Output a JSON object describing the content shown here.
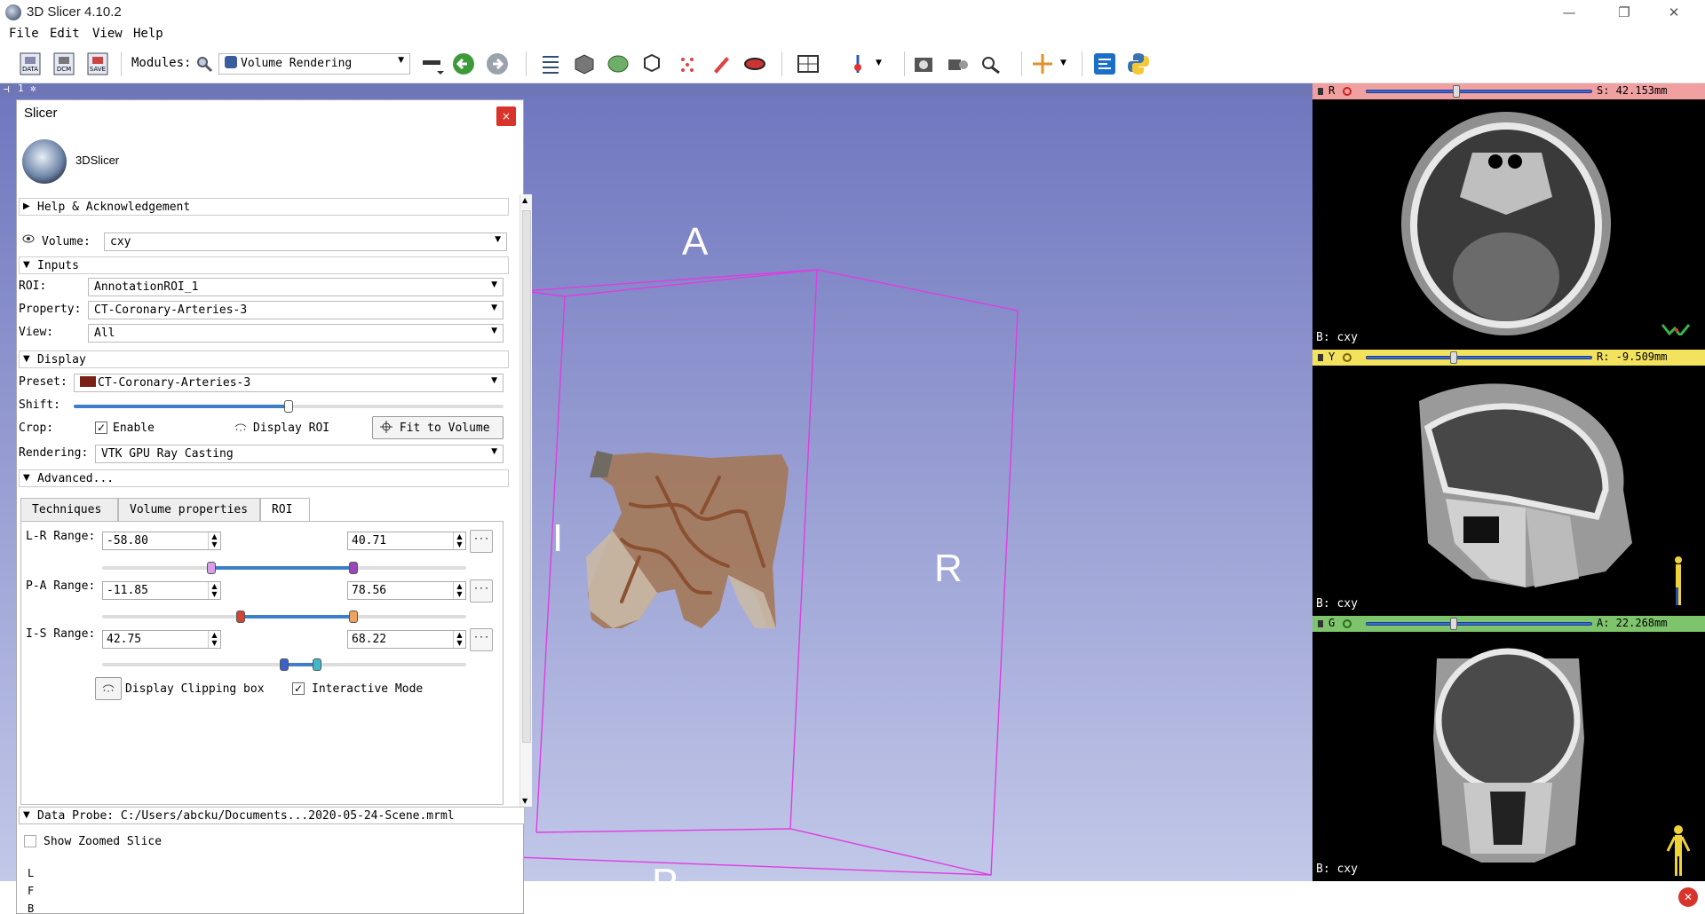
{
  "window": {
    "title": "3D Slicer 4.10.2",
    "minimize": "—",
    "restore": "❐",
    "close": "✕"
  },
  "menu": [
    "File",
    "Edit",
    "View",
    "Help"
  ],
  "toolbar": {
    "modules_label": "Modules:",
    "module_selected": "Volume Rendering",
    "data_label": "DATA",
    "dcm_label": "DCM",
    "save_label": "SAVE"
  },
  "viewstrip": {
    "label": "1"
  },
  "view3d": {
    "labels": {
      "anterior": "A",
      "right": "R",
      "inferior": "I",
      "posterior": "P"
    }
  },
  "slices": [
    {
      "color": "#f0a0a0",
      "letter": "R",
      "value": "S: 42.153mm",
      "knob_frac": 0.4,
      "volume": "B: cxy"
    },
    {
      "color": "#f3e25e",
      "letter": "Y",
      "value": "R: -9.509mm",
      "knob_frac": 0.39,
      "volume": "B: cxy"
    },
    {
      "color": "#7ec46d",
      "letter": "G",
      "value": "A: 22.268mm",
      "knob_frac": 0.39,
      "volume": "B: cxy"
    }
  ],
  "panel": {
    "title": "Slicer",
    "close": "×",
    "logo_text": "3DSlicer",
    "help_section": "Help & Acknowledgement",
    "volume_label": "Volume:",
    "volume_value": "cxy",
    "inputs_section": "Inputs",
    "roi_label": "ROI:",
    "roi_value": "AnnotationROI_1",
    "property_label": "Property:",
    "property_value": "CT-Coronary-Arteries-3",
    "view_label": "View:",
    "view_value": "All",
    "display_section": "Display",
    "preset_label": "Preset:",
    "preset_value": "CT-Coronary-Arteries-3",
    "shift_label": "Shift:",
    "shift_frac": 0.5,
    "crop_label": "Crop:",
    "enable_label": "Enable",
    "display_roi_label": "Display ROI",
    "fit_button": "Fit to Volume",
    "rendering_label": "Rendering:",
    "rendering_value": "VTK GPU Ray Casting",
    "advanced_section": "Advanced...",
    "tabs": [
      "Techniques",
      "Volume properties",
      "ROI"
    ],
    "lr": {
      "label": "L-R Range:",
      "min": "-58.80",
      "max": "40.71",
      "lo_frac": 0.3,
      "hi_frac": 0.69,
      "lo_color": "#d89ee6",
      "hi_color": "#9a47b8"
    },
    "pa": {
      "label": "P-A Range:",
      "min": "-11.85",
      "max": "78.56",
      "lo_frac": 0.38,
      "hi_frac": 0.69,
      "lo_color": "#d44436",
      "hi_color": "#f0a35e"
    },
    "is": {
      "label": "I-S Range:",
      "min": "42.75",
      "max": "68.22",
      "lo_frac": 0.5,
      "hi_frac": 0.59,
      "lo_color": "#3c62c8",
      "hi_color": "#41b8c8"
    },
    "display_clipping_label": "Display Clipping box",
    "interactive_mode_label": "Interactive Mode",
    "data_probe": "Data Probe: C:/Users/abcku/Documents...2020-05-24-Scene.mrml",
    "show_zoomed_label": "Show Zoomed Slice",
    "probe_rows": [
      "L",
      "F",
      "B"
    ]
  }
}
